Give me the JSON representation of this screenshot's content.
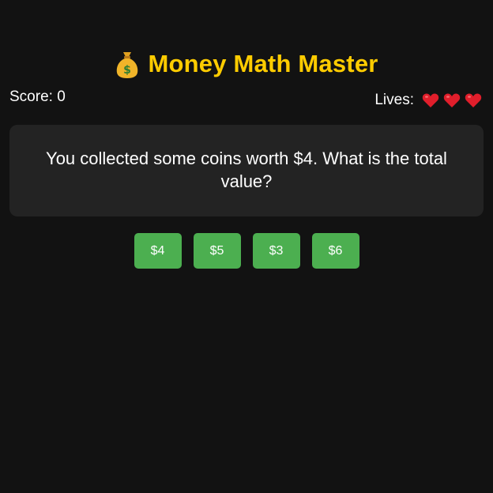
{
  "game": {
    "title": "Money Math Master",
    "title_icon": "money-bag-icon",
    "accent_color": "#ffcc00",
    "background_color": "#121212"
  },
  "status": {
    "score_label": "Score: 0",
    "lives_label": "Lives:",
    "lives_remaining": 3,
    "heart_icon": "heart-icon",
    "heart_color": "#e01e2b"
  },
  "question": {
    "text": "You collected some coins worth $4. What is the total value?"
  },
  "answers": {
    "button_color": "#4caf50",
    "options": [
      {
        "label": "$4"
      },
      {
        "label": "$5"
      },
      {
        "label": "$3"
      },
      {
        "label": "$6"
      }
    ]
  }
}
